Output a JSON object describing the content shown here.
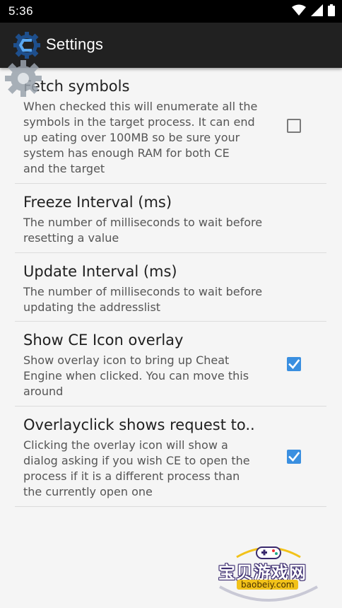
{
  "status_bar": {
    "time": "5:36",
    "icons": [
      "wifi-icon",
      "signal-icon",
      "battery-icon"
    ]
  },
  "app_bar": {
    "title": "Settings",
    "logo_icon": "cheat-engine-logo-icon"
  },
  "overlay_icon": "gear-icon",
  "preferences": [
    {
      "title": "Fetch symbols",
      "summary_lines": [
        "When checked this will enumerate all the",
        "symbols in the target process. It can end",
        "up eating over 100MB so be sure your",
        "system has enough RAM for both CE",
        "and the target"
      ],
      "has_checkbox": true,
      "checked": false
    },
    {
      "title": "Freeze Interval (ms)",
      "summary_lines": [
        "The number of milliseconds to wait before",
        "resetting a value"
      ],
      "has_checkbox": false
    },
    {
      "title": "Update Interval (ms)",
      "summary_lines": [
        "The number of milliseconds to wait before",
        "updating the addresslist"
      ],
      "has_checkbox": false
    },
    {
      "title": "Show CE Icon overlay",
      "summary_lines": [
        "Show overlay icon to bring up Cheat",
        "Engine when clicked. You can move this",
        "around"
      ],
      "has_checkbox": true,
      "checked": true
    },
    {
      "title": "Overlayclick shows request to..",
      "summary_lines": [
        "Clicking the overlay icon will show a",
        "dialog asking if you wish CE to open the",
        "process if it is a different process than",
        "the currently open one"
      ],
      "has_checkbox": true,
      "checked": true
    }
  ],
  "watermark": {
    "text": "宝贝游戏网",
    "url": "baobeiy.com",
    "icon": "gamepad-icon"
  },
  "colors": {
    "background": "#f5f5f5",
    "app_bar": "#212121",
    "status_bar": "#000000",
    "checkbox_checked": "#3a8fe0",
    "divider": "#dcdcdc"
  }
}
